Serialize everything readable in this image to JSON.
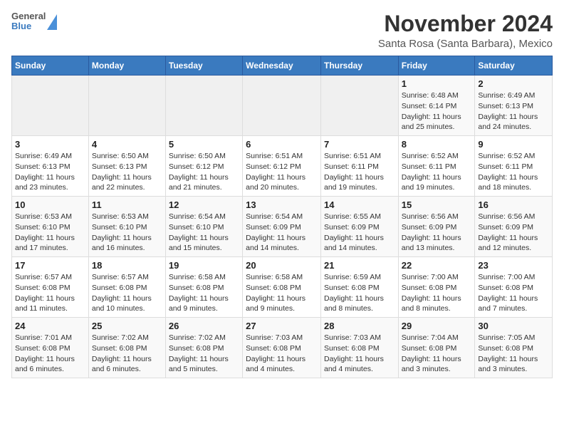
{
  "header": {
    "logo_line1": "General",
    "logo_line2": "Blue",
    "month": "November 2024",
    "location": "Santa Rosa (Santa Barbara), Mexico"
  },
  "weekdays": [
    "Sunday",
    "Monday",
    "Tuesday",
    "Wednesday",
    "Thursday",
    "Friday",
    "Saturday"
  ],
  "weeks": [
    [
      {
        "day": "",
        "info": ""
      },
      {
        "day": "",
        "info": ""
      },
      {
        "day": "",
        "info": ""
      },
      {
        "day": "",
        "info": ""
      },
      {
        "day": "",
        "info": ""
      },
      {
        "day": "1",
        "info": "Sunrise: 6:48 AM\nSunset: 6:14 PM\nDaylight: 11 hours and 25 minutes."
      },
      {
        "day": "2",
        "info": "Sunrise: 6:49 AM\nSunset: 6:13 PM\nDaylight: 11 hours and 24 minutes."
      }
    ],
    [
      {
        "day": "3",
        "info": "Sunrise: 6:49 AM\nSunset: 6:13 PM\nDaylight: 11 hours and 23 minutes."
      },
      {
        "day": "4",
        "info": "Sunrise: 6:50 AM\nSunset: 6:13 PM\nDaylight: 11 hours and 22 minutes."
      },
      {
        "day": "5",
        "info": "Sunrise: 6:50 AM\nSunset: 6:12 PM\nDaylight: 11 hours and 21 minutes."
      },
      {
        "day": "6",
        "info": "Sunrise: 6:51 AM\nSunset: 6:12 PM\nDaylight: 11 hours and 20 minutes."
      },
      {
        "day": "7",
        "info": "Sunrise: 6:51 AM\nSunset: 6:11 PM\nDaylight: 11 hours and 19 minutes."
      },
      {
        "day": "8",
        "info": "Sunrise: 6:52 AM\nSunset: 6:11 PM\nDaylight: 11 hours and 19 minutes."
      },
      {
        "day": "9",
        "info": "Sunrise: 6:52 AM\nSunset: 6:11 PM\nDaylight: 11 hours and 18 minutes."
      }
    ],
    [
      {
        "day": "10",
        "info": "Sunrise: 6:53 AM\nSunset: 6:10 PM\nDaylight: 11 hours and 17 minutes."
      },
      {
        "day": "11",
        "info": "Sunrise: 6:53 AM\nSunset: 6:10 PM\nDaylight: 11 hours and 16 minutes."
      },
      {
        "day": "12",
        "info": "Sunrise: 6:54 AM\nSunset: 6:10 PM\nDaylight: 11 hours and 15 minutes."
      },
      {
        "day": "13",
        "info": "Sunrise: 6:54 AM\nSunset: 6:09 PM\nDaylight: 11 hours and 14 minutes."
      },
      {
        "day": "14",
        "info": "Sunrise: 6:55 AM\nSunset: 6:09 PM\nDaylight: 11 hours and 14 minutes."
      },
      {
        "day": "15",
        "info": "Sunrise: 6:56 AM\nSunset: 6:09 PM\nDaylight: 11 hours and 13 minutes."
      },
      {
        "day": "16",
        "info": "Sunrise: 6:56 AM\nSunset: 6:09 PM\nDaylight: 11 hours and 12 minutes."
      }
    ],
    [
      {
        "day": "17",
        "info": "Sunrise: 6:57 AM\nSunset: 6:08 PM\nDaylight: 11 hours and 11 minutes."
      },
      {
        "day": "18",
        "info": "Sunrise: 6:57 AM\nSunset: 6:08 PM\nDaylight: 11 hours and 10 minutes."
      },
      {
        "day": "19",
        "info": "Sunrise: 6:58 AM\nSunset: 6:08 PM\nDaylight: 11 hours and 9 minutes."
      },
      {
        "day": "20",
        "info": "Sunrise: 6:58 AM\nSunset: 6:08 PM\nDaylight: 11 hours and 9 minutes."
      },
      {
        "day": "21",
        "info": "Sunrise: 6:59 AM\nSunset: 6:08 PM\nDaylight: 11 hours and 8 minutes."
      },
      {
        "day": "22",
        "info": "Sunrise: 7:00 AM\nSunset: 6:08 PM\nDaylight: 11 hours and 8 minutes."
      },
      {
        "day": "23",
        "info": "Sunrise: 7:00 AM\nSunset: 6:08 PM\nDaylight: 11 hours and 7 minutes."
      }
    ],
    [
      {
        "day": "24",
        "info": "Sunrise: 7:01 AM\nSunset: 6:08 PM\nDaylight: 11 hours and 6 minutes."
      },
      {
        "day": "25",
        "info": "Sunrise: 7:02 AM\nSunset: 6:08 PM\nDaylight: 11 hours and 6 minutes."
      },
      {
        "day": "26",
        "info": "Sunrise: 7:02 AM\nSunset: 6:08 PM\nDaylight: 11 hours and 5 minutes."
      },
      {
        "day": "27",
        "info": "Sunrise: 7:03 AM\nSunset: 6:08 PM\nDaylight: 11 hours and 4 minutes."
      },
      {
        "day": "28",
        "info": "Sunrise: 7:03 AM\nSunset: 6:08 PM\nDaylight: 11 hours and 4 minutes."
      },
      {
        "day": "29",
        "info": "Sunrise: 7:04 AM\nSunset: 6:08 PM\nDaylight: 11 hours and 3 minutes."
      },
      {
        "day": "30",
        "info": "Sunrise: 7:05 AM\nSunset: 6:08 PM\nDaylight: 11 hours and 3 minutes."
      }
    ]
  ]
}
